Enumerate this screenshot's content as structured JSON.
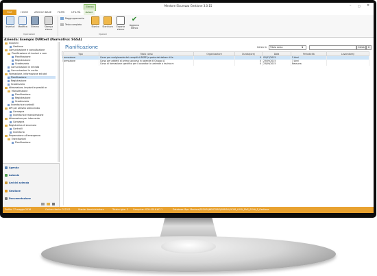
{
  "app": {
    "title": "Mentore Sicurezza Gestione 3.0.15"
  },
  "window_controls": {
    "minimize": "–",
    "maximize": "□",
    "close": "×"
  },
  "tabs": [
    {
      "label": "FILE"
    },
    {
      "label": "HOME"
    },
    {
      "label": "ARCHIVI BASE"
    },
    {
      "label": "FILTRI"
    },
    {
      "label": "UTILITÀ"
    }
  ],
  "context_tab": {
    "group": "Elenco",
    "label": "Azioni"
  },
  "ribbon": {
    "operations": {
      "label": "Operazioni",
      "buttons": [
        "Inserisci",
        "Modifica",
        "Elimina",
        "Stampa elenco"
      ]
    },
    "options": {
      "label": "Opzioni",
      "small_buttons": [
        "Raggruppamento",
        "Testo completo"
      ],
      "buttons": [
        "Storico",
        "Storicizza",
        "Esporta elenco",
        "Aggiorna elenco"
      ]
    }
  },
  "azienda": "Azienda: Esempio DVRtest (Normativa: SGSA)",
  "tree": [
    "Incarichi",
    "Gestione",
    "Comunicazione e consultazione",
    "Pianificazione di riunioni e com",
    "Pianificazione",
    "Registrazione",
    "Scadenzario",
    "Comunicazioni in entrata",
    "Comunicazioni in uscita",
    "Formazione, informazione ed add",
    "Pianificazione",
    "Registrazione",
    "Scadenzario",
    "Attrezzature, impianti e presidi ar",
    "Manutenzione",
    "Pianificazione",
    "Registrazione",
    "Scadenzario",
    "Inventario e controlli",
    "DPI per attività antincendio",
    "Consegna",
    "Inventario e manutenzione",
    "Attrezzature per intervento",
    "Consegna",
    "Registratica di sicurezza",
    "Controlli",
    "Inventario",
    "Preparazione all'emergenza",
    "Esercitazioni",
    "Pianificazione"
  ],
  "nav": [
    "Agenda",
    "Aziende",
    "Archivi azienda",
    "Gestione",
    "Documentazione"
  ],
  "page": {
    "title": "Pianificazione"
  },
  "search": {
    "label": "Cerca in",
    "field": "Titolo corso",
    "button": "Cerca",
    "clear": "X"
  },
  "table": {
    "columns": [
      "Tipo",
      "Titolo corso",
      "Organizzatore",
      "Durata(ore)",
      "Data",
      "Periodicità",
      "Lavoratore/i"
    ],
    "rows": [
      [
        "Formazione",
        "Corso per svolgimento dei compiti di RSPP (a parte dei datore di la",
        "",
        "0",
        "02/07/2015",
        "5 Anni",
        ""
      ],
      [
        "Formazione",
        "Corso per addetti al primo soccorso in aziende di Gruppo A",
        "",
        "0",
        "23/09/2015",
        "3 Anni",
        ""
      ],
      [
        "",
        "Corso di formazione specifica per i lavoratori in aziende a rischio m",
        "",
        "0",
        "23/09/2015",
        "Nessuna",
        ""
      ]
    ]
  },
  "status": [
    "Profilo: 17 maggio 2016",
    "Codice cliente: 312311",
    "Utente: Amministratore",
    "Totale righe: 3",
    "Computer: SCH-0016-W7-1",
    "Database: Bpc: Mentore\\SEGURI\\MENTORE\\DVRISA\\SICUR_LOCK_DVS_SCHA_P_Gestione"
  ]
}
